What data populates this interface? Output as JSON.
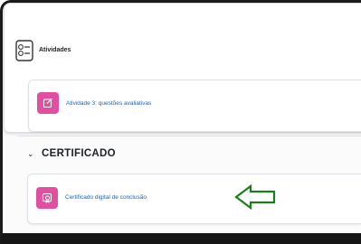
{
  "atividades": {
    "title": "Atividades",
    "items": [
      {
        "label": "Atividade 3: questões avaliativas",
        "icon": "assignment-icon"
      }
    ]
  },
  "certificado": {
    "title": "CERTIFICADO",
    "items": [
      {
        "label": "Certificado digital de conclusão",
        "icon": "certificate-icon"
      }
    ]
  },
  "colors": {
    "activity_icon_bg": "#e24fa0",
    "link": "#1565c0",
    "arrow": "#1a7d1a"
  }
}
